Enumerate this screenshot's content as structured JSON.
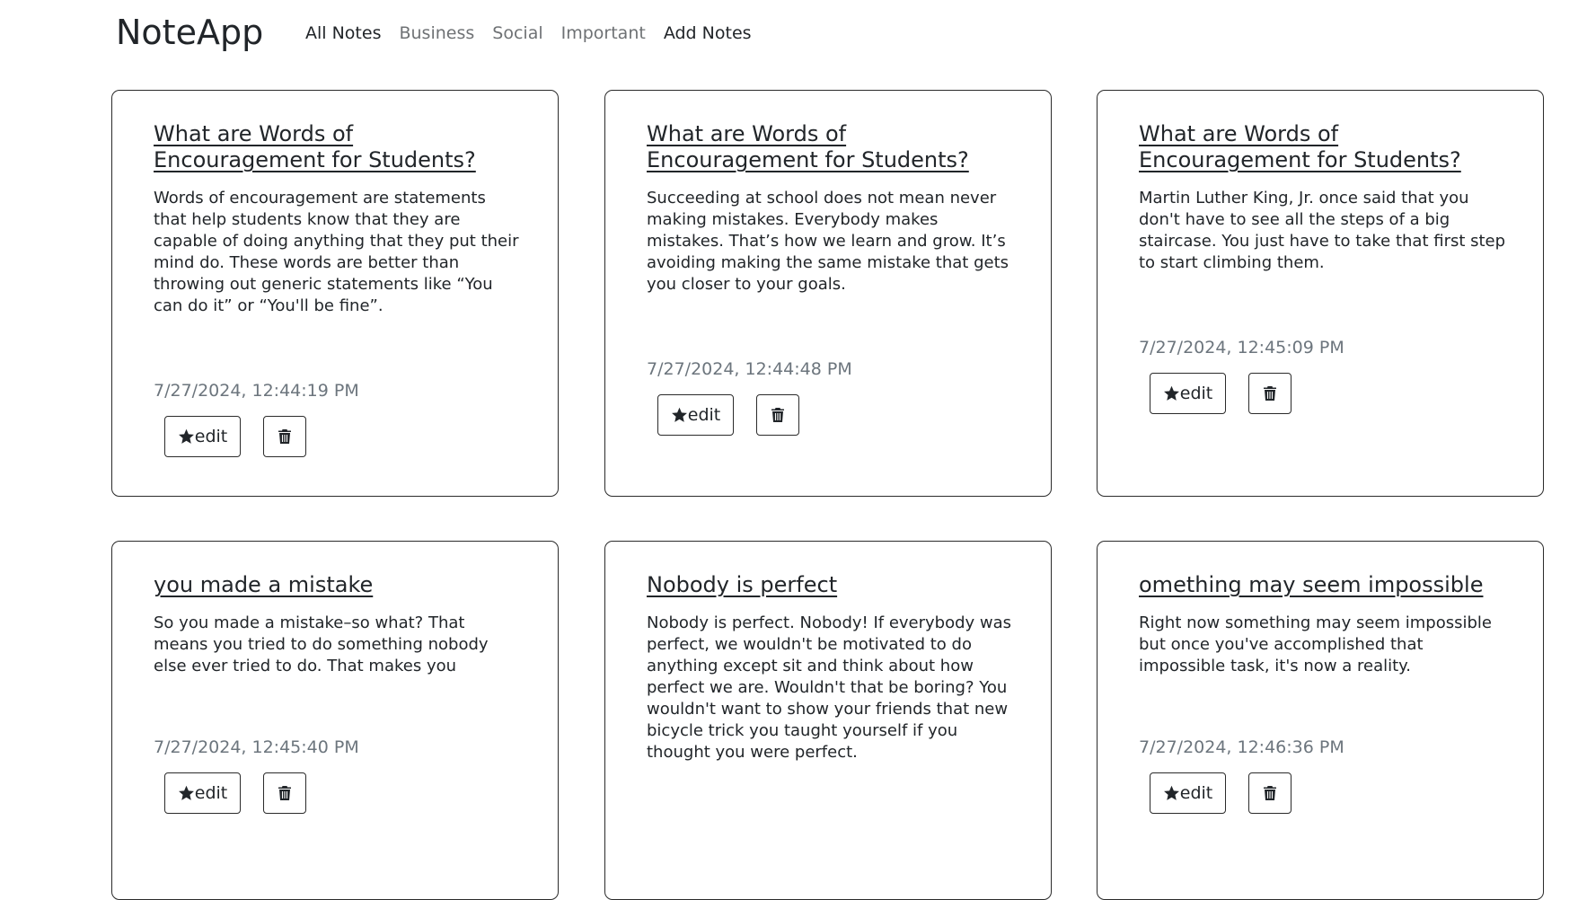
{
  "app": {
    "brand": "NoteApp"
  },
  "nav": {
    "items": [
      {
        "label": "All Notes",
        "active": true
      },
      {
        "label": "Business",
        "active": false
      },
      {
        "label": "Social",
        "active": false
      },
      {
        "label": "Important",
        "active": false
      },
      {
        "label": "Add Notes",
        "active": true
      }
    ]
  },
  "notes": [
    {
      "title": "What are Words of Encouragement for Students?",
      "text": "Words of encouragement are statements that help students know that they are capable of doing anything that they put their mind do. These words are better than throwing out generic statements like “You can do it” or “You'll be fine”.",
      "date": "7/27/2024, 12:44:19 PM",
      "edit_label": "edit",
      "edit_icon": "star-icon",
      "delete_icon": "trash-icon"
    },
    {
      "title": "What are Words of Encouragement for Students?",
      "text": "Succeeding at school does not mean never making mistakes. Everybody makes mistakes. That’s how we learn and grow. It’s avoiding making the same mistake that gets you closer to your goals.",
      "date": "7/27/2024, 12:44:48 PM",
      "edit_label": "edit",
      "edit_icon": "star-icon",
      "delete_icon": "trash-icon"
    },
    {
      "title": "What are Words of Encouragement for Students?",
      "text": "Martin Luther King, Jr. once said that you don't have to see all the steps of a big staircase. You just have to take that first step to start climbing them.",
      "date": "7/27/2024, 12:45:09 PM",
      "edit_label": "edit",
      "edit_icon": "star-icon",
      "delete_icon": "trash-icon"
    },
    {
      "title": "you made a mistake",
      "text": "So you made a mistake–so what? That means you tried to do something nobody else ever tried to do. That makes you",
      "date": "7/27/2024, 12:45:40 PM",
      "edit_label": "edit",
      "edit_icon": "star-icon",
      "delete_icon": "trash-icon"
    },
    {
      "title": "Nobody is perfect",
      "text": "Nobody is perfect. Nobody! If everybody was perfect, we wouldn't be motivated to do anything except sit and think about how perfect we are. Wouldn't that be boring? You wouldn't want to show your friends that new bicycle trick you taught yourself if you thought you were perfect.",
      "edit_label": "edit",
      "edit_icon": "star-icon",
      "delete_icon": "trash-icon"
    },
    {
      "title": "omething may seem impossible",
      "text": "Right now something may seem impossible but once you've accomplished that impossible task, it's now a reality.",
      "date": "7/27/2024, 12:46:36 PM",
      "edit_label": "edit",
      "edit_icon": "star-icon",
      "delete_icon": "trash-icon"
    }
  ]
}
